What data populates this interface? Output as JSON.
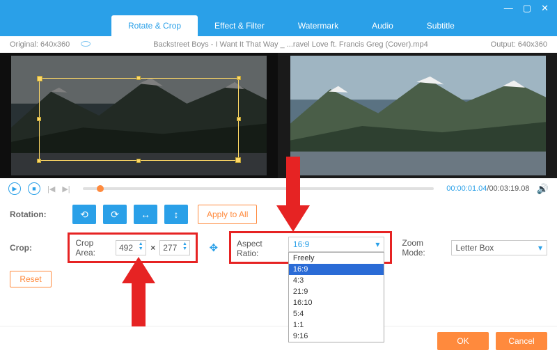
{
  "tabs": [
    "Rotate & Crop",
    "Effect & Filter",
    "Watermark",
    "Audio",
    "Subtitle"
  ],
  "active_tab": 0,
  "info": {
    "original_label": "Original:",
    "original_dim": "640x360",
    "output_label": "Output:",
    "output_dim": "640x360",
    "title": "Backstreet Boys - I Want It That Way _ ...ravel Love ft. Francis Greg (Cover).mp4"
  },
  "playbar": {
    "current": "00:00:01.04",
    "total": "00:03:19.08"
  },
  "rotation": {
    "label": "Rotation:",
    "apply": "Apply to All"
  },
  "crop": {
    "label": "Crop:",
    "area_label": "Crop Area:",
    "w": "492",
    "h": "277",
    "reset": "Reset"
  },
  "aspect": {
    "label": "Aspect Ratio:",
    "selected": "16:9",
    "options": [
      "Freely",
      "16:9",
      "4:3",
      "21:9",
      "16:10",
      "5:4",
      "1:1",
      "9:16"
    ]
  },
  "zoom": {
    "label": "Zoom Mode:",
    "selected": "Letter Box"
  },
  "footer": {
    "ok": "OK",
    "cancel": "Cancel"
  }
}
